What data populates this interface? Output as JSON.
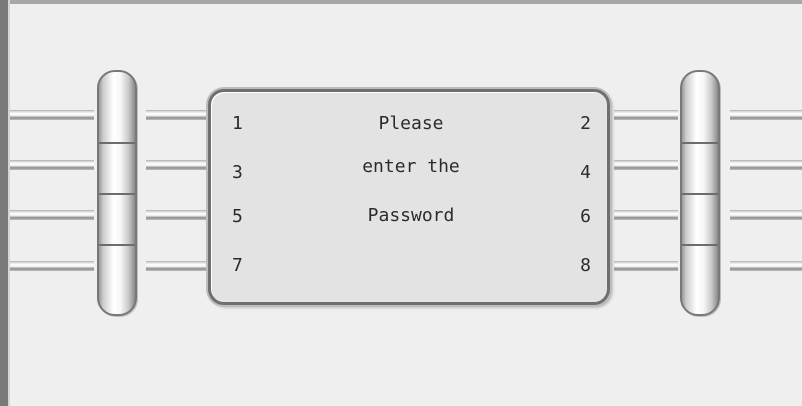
{
  "panel": {
    "message_lines": [
      "Please",
      "enter the",
      "Password",
      ""
    ],
    "slot_numbers": {
      "left": [
        "1",
        "3",
        "5",
        "7"
      ],
      "right": [
        "2",
        "4",
        "6",
        "8"
      ]
    }
  }
}
